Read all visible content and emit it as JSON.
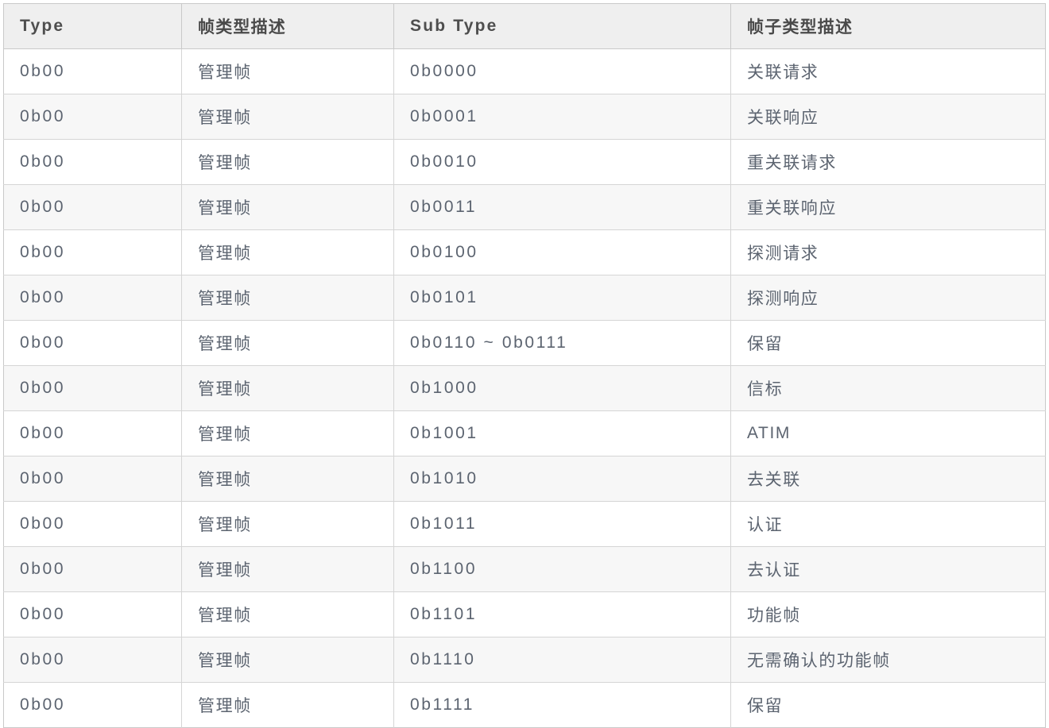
{
  "table": {
    "columns": [
      {
        "key": "type",
        "label": "Type",
        "lang": "en"
      },
      {
        "key": "type_desc",
        "label": "帧类型描述",
        "lang": "cn"
      },
      {
        "key": "sub_type",
        "label": "Sub Type",
        "lang": "en"
      },
      {
        "key": "sub_type_desc",
        "label": "帧子类型描述",
        "lang": "cn"
      }
    ],
    "rows": [
      {
        "type": "0b00",
        "type_desc": "管理帧",
        "sub_type": "0b0000",
        "sub_type_desc": "关联请求"
      },
      {
        "type": "0b00",
        "type_desc": "管理帧",
        "sub_type": "0b0001",
        "sub_type_desc": "关联响应"
      },
      {
        "type": "0b00",
        "type_desc": "管理帧",
        "sub_type": "0b0010",
        "sub_type_desc": "重关联请求"
      },
      {
        "type": "0b00",
        "type_desc": "管理帧",
        "sub_type": "0b0011",
        "sub_type_desc": "重关联响应"
      },
      {
        "type": "0b00",
        "type_desc": "管理帧",
        "sub_type": "0b0100",
        "sub_type_desc": "探测请求"
      },
      {
        "type": "0b00",
        "type_desc": "管理帧",
        "sub_type": "0b0101",
        "sub_type_desc": "探测响应"
      },
      {
        "type": "0b00",
        "type_desc": "管理帧",
        "sub_type": "0b0110 ~ 0b0111",
        "sub_type_desc": "保留"
      },
      {
        "type": "0b00",
        "type_desc": "管理帧",
        "sub_type": "0b1000",
        "sub_type_desc": "信标"
      },
      {
        "type": "0b00",
        "type_desc": "管理帧",
        "sub_type": "0b1001",
        "sub_type_desc": "ATIM"
      },
      {
        "type": "0b00",
        "type_desc": "管理帧",
        "sub_type": "0b1010",
        "sub_type_desc": "去关联"
      },
      {
        "type": "0b00",
        "type_desc": "管理帧",
        "sub_type": "0b1011",
        "sub_type_desc": "认证"
      },
      {
        "type": "0b00",
        "type_desc": "管理帧",
        "sub_type": "0b1100",
        "sub_type_desc": "去认证"
      },
      {
        "type": "0b00",
        "type_desc": "管理帧",
        "sub_type": "0b1101",
        "sub_type_desc": "功能帧"
      },
      {
        "type": "0b00",
        "type_desc": "管理帧",
        "sub_type": "0b1110",
        "sub_type_desc": "无需确认的功能帧"
      },
      {
        "type": "0b00",
        "type_desc": "管理帧",
        "sub_type": "0b1111",
        "sub_type_desc": "保留"
      }
    ]
  },
  "colors": {
    "header_bg": "#efefef",
    "header_text": "#4e4e4e",
    "cell_text": "#5c6470",
    "row_stripe": "#f7f7f7",
    "row_base": "#ffffff",
    "border": "#d5d5d5",
    "outer_border": "#c9c9c9"
  }
}
